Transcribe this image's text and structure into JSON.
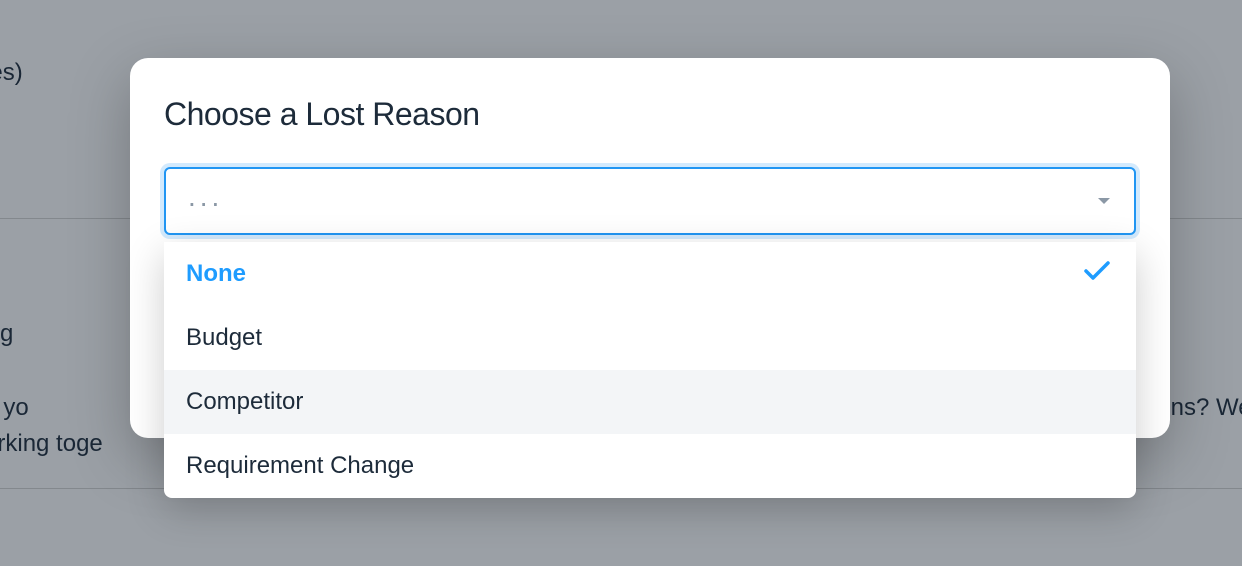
{
  "background": {
    "text1": "Haines)",
    "text2": "g",
    "text3": "k in with yo",
    "text4": "to working toge",
    "text5": "ions? We'r"
  },
  "modal": {
    "title": "Choose a Lost Reason",
    "select": {
      "placeholder": "..."
    },
    "options": [
      {
        "label": "None",
        "selected": true,
        "hovered": false
      },
      {
        "label": "Budget",
        "selected": false,
        "hovered": false
      },
      {
        "label": "Competitor",
        "selected": false,
        "hovered": true
      },
      {
        "label": "Requirement Change",
        "selected": false,
        "hovered": false
      }
    ]
  },
  "colors": {
    "accent": "#1e9cff",
    "border_focus": "#2196f3",
    "text": "#1d2b3a",
    "muted": "#8a97a5"
  }
}
